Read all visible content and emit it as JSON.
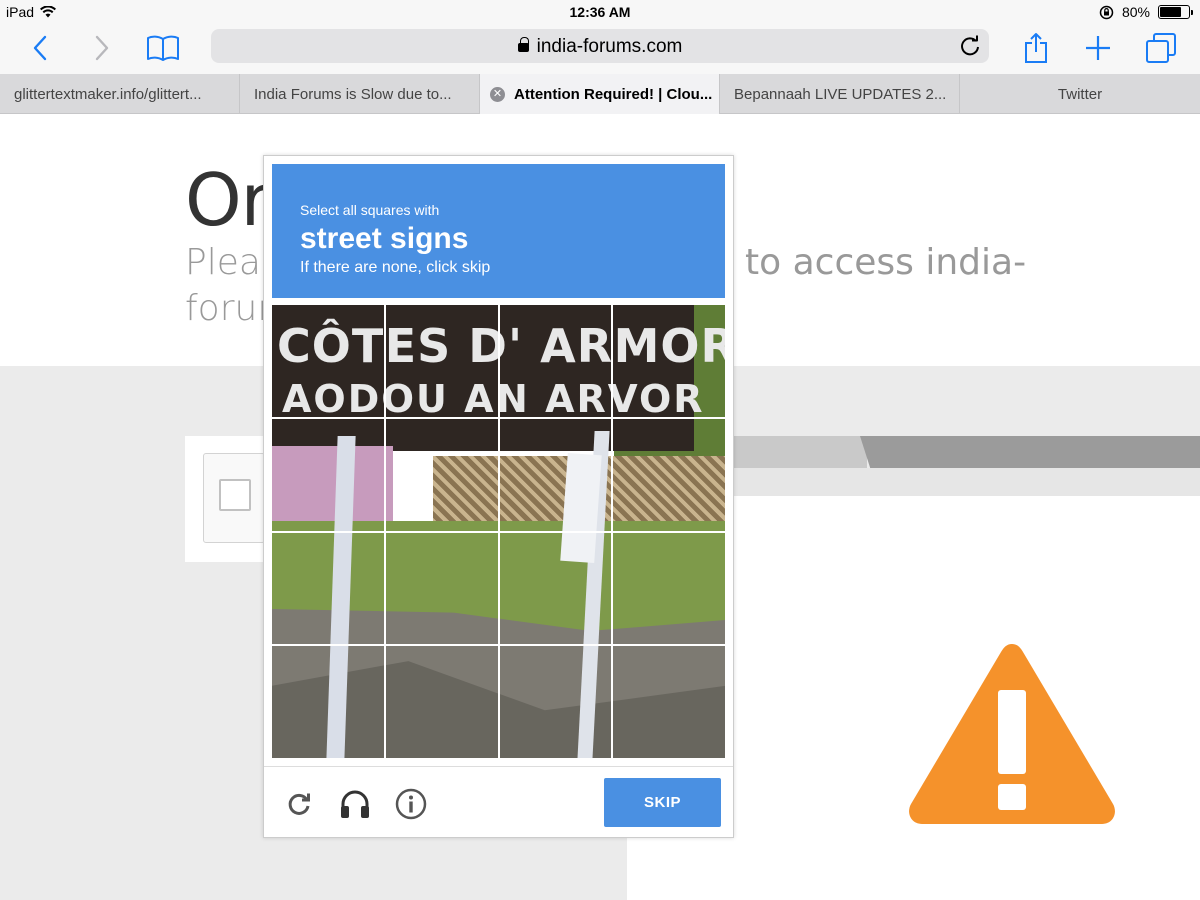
{
  "status_bar": {
    "device": "iPad",
    "time": "12:36 AM",
    "battery": "80%",
    "battery_level": 0.8
  },
  "toolbar": {
    "url": "india-forums.com"
  },
  "tabs": [
    {
      "label": "glittertextmaker.info/glittert..."
    },
    {
      "label": "India Forums is Slow due to..."
    },
    {
      "label": "Attention Required! | Clou...",
      "active": true
    },
    {
      "label": "Bepannaah LIVE UPDATES 2..."
    },
    {
      "label": "Twitter"
    }
  ],
  "page": {
    "heading_fragment": "Or",
    "sub_left_line1": "Pleas",
    "sub_left_line2": "forun",
    "sub_right": "to access india-"
  },
  "captcha": {
    "instruction_small": "Select all squares with",
    "target": "street signs",
    "hint": "If there are none, click skip",
    "sign_line1": "CÔTES D' ARMOR",
    "sign_line2": "AODOU AN ARVOR",
    "skip_label": "SKIP",
    "accent_color": "#4a90e2"
  },
  "colors": {
    "warning": "#f5922b",
    "ios_blue": "#1a7cf5"
  }
}
